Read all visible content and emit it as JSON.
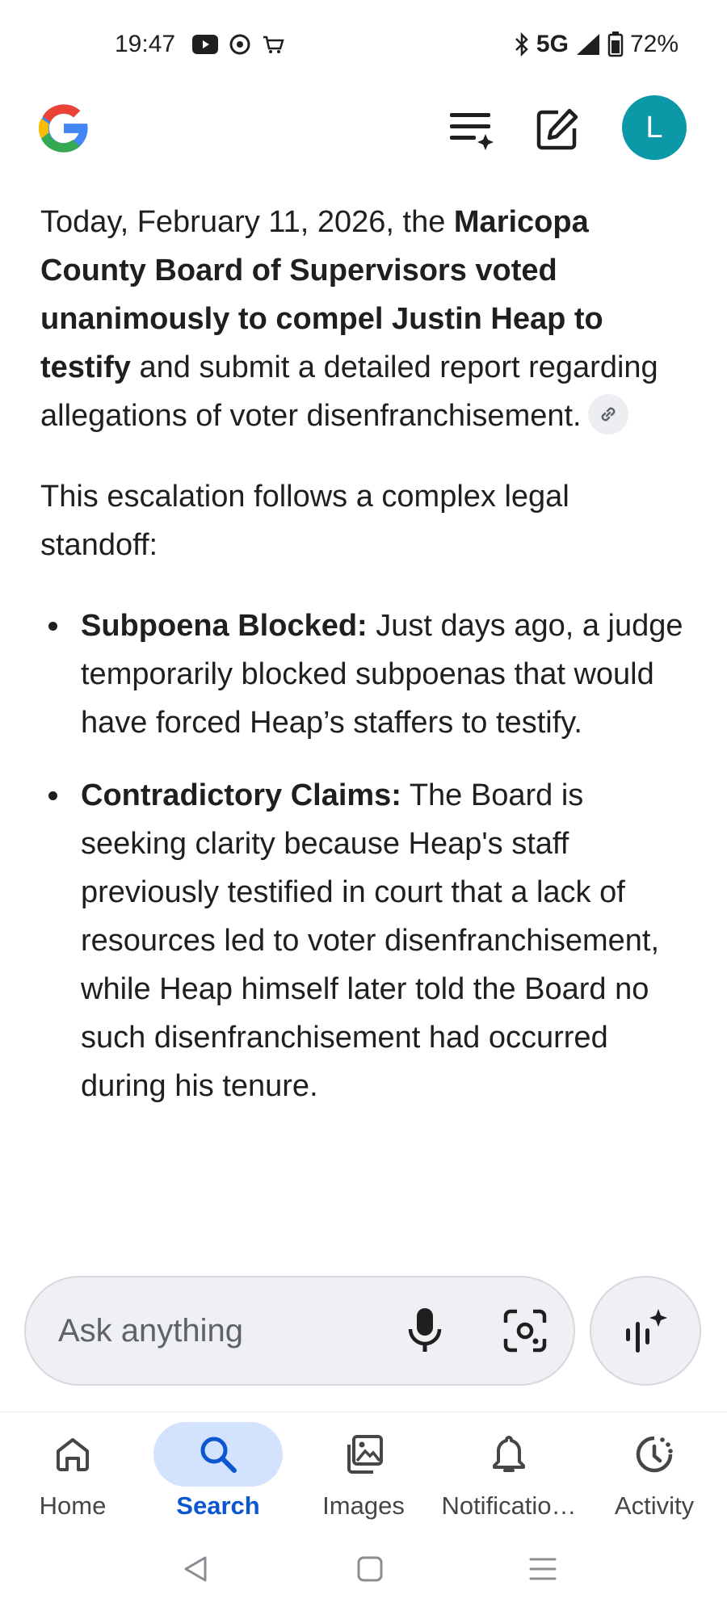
{
  "status_bar": {
    "time": "19:47",
    "network": "5G",
    "battery": "72%"
  },
  "app_bar": {
    "avatar_letter": "L"
  },
  "content": {
    "para1": {
      "pre": "Today, February 11, 2026, the ",
      "bold": "Maricopa County Board of Supervisors voted unanimously to compel Justin Heap to testify",
      "post": " and submit a detailed report regarding allegations of voter disenfranchisement."
    },
    "para2": "This escalation follows a complex legal standoff:",
    "bullets": [
      {
        "title": "Subpoena Blocked:",
        "text": " Just days ago, a judge temporarily blocked subpoenas that would have forced Heap’s staffers to testify."
      },
      {
        "title": "Contradictory Claims:",
        "text": " The Board is seeking clarity because Heap's staff previously testified in court that a lack of resources led to voter disenfranchisement, while Heap himself later told the Board no such disenfranchisement had occurred during his tenure."
      }
    ]
  },
  "ask_bar": {
    "placeholder": "Ask anything"
  },
  "bottom_nav": {
    "items": [
      {
        "label": "Home",
        "icon": "home-icon"
      },
      {
        "label": "Search",
        "icon": "search-icon",
        "active": true
      },
      {
        "label": "Images",
        "icon": "images-icon"
      },
      {
        "label": "Notificatio…",
        "icon": "bell-icon"
      },
      {
        "label": "Activity",
        "icon": "activity-icon"
      }
    ]
  },
  "colors": {
    "accent": "#0b57d0",
    "active_pill": "#d3e3fd",
    "avatar_bg": "#0b98a7",
    "ask_bg": "#eef0f4"
  }
}
